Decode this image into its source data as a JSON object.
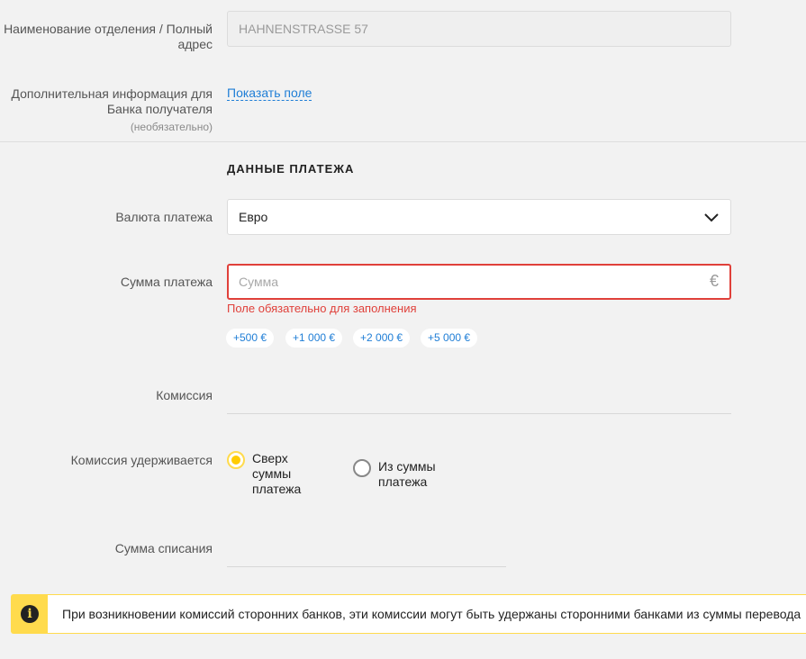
{
  "branch": {
    "label": "Наименование отделения / Полный адрес",
    "value": "HAHNENSTRASSE 57"
  },
  "additional_info": {
    "label": "Дополнительная информация для Банка получателя",
    "hint": "(необязательно)",
    "link": "Показать поле"
  },
  "payment": {
    "section_title": "ДАННЫЕ ПЛАТЕЖА",
    "currency_label": "Валюта платежа",
    "currency_value": "Евро",
    "amount_label": "Сумма платежа",
    "amount_placeholder": "Сумма",
    "amount_value": "",
    "currency_symbol": "€",
    "amount_error": "Поле обязательно для заполнения",
    "quick_amounts": [
      "+500 €",
      "+1 000 €",
      "+2 000 €",
      "+5 000 €"
    ],
    "commission_label": "Комиссия",
    "commission_value": "",
    "commission_mode_label": "Комиссия удерживается",
    "commission_modes": [
      {
        "label": "Сверх суммы платежа",
        "selected": true
      },
      {
        "label": "Из суммы платежа",
        "selected": false
      }
    ],
    "debit_label": "Сумма списания",
    "debit_value": ""
  },
  "notice": {
    "icon": "info-icon",
    "text": "При возникновении комиссий сторонних банков, эти комиссии могут быть удержаны сторонними банками из суммы перевода"
  },
  "colors": {
    "accent": "#ffdb4d",
    "link": "#1f7ed6",
    "error": "#e0403a"
  }
}
